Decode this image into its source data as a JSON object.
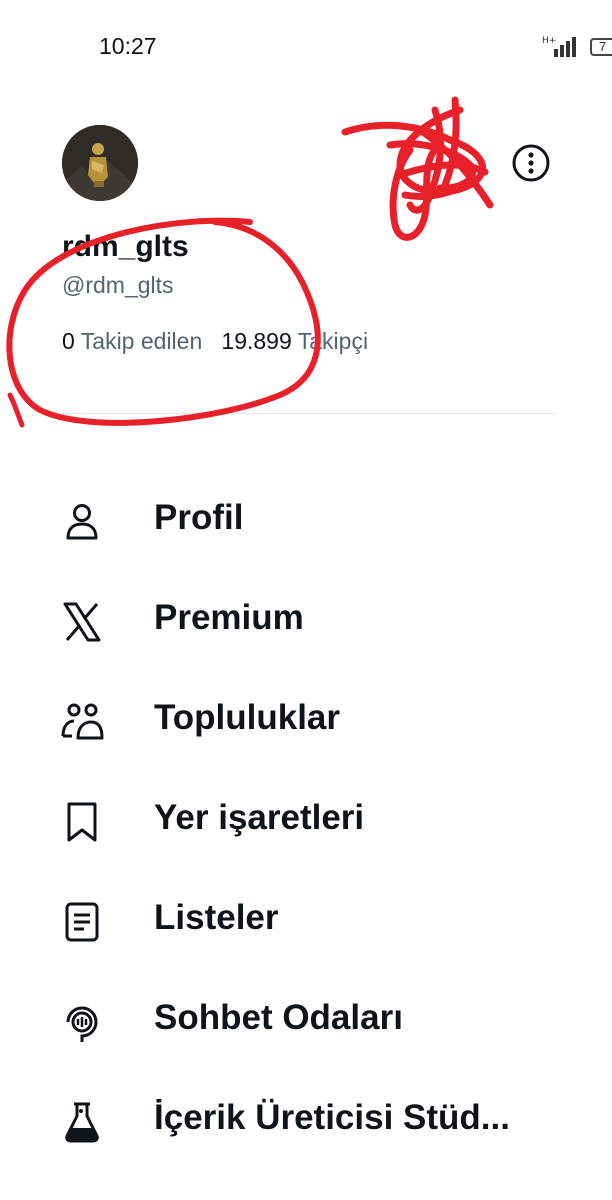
{
  "status_bar": {
    "time": "10:27",
    "network": "H+",
    "battery": "7"
  },
  "profile": {
    "display_name": "rdm_glts",
    "handle": "@rdm_glts",
    "following_count": "0",
    "following_label": "Takip edilen",
    "followers_count": "19.899",
    "followers_label": "Takipçi"
  },
  "menu": [
    {
      "label": "Profil",
      "icon": "person-icon"
    },
    {
      "label": "Premium",
      "icon": "x-logo-icon"
    },
    {
      "label": "Topluluklar",
      "icon": "communities-icon"
    },
    {
      "label": "Yer işaretleri",
      "icon": "bookmark-icon"
    },
    {
      "label": "Listeler",
      "icon": "list-icon"
    },
    {
      "label": "Sohbet Odaları",
      "icon": "spaces-icon"
    },
    {
      "label": "İçerik Üreticisi Stüd...",
      "icon": "flask-icon"
    }
  ],
  "colors": {
    "primary_text": "#0f1419",
    "secondary_text": "#536471",
    "annotation_red": "#e8202a"
  }
}
